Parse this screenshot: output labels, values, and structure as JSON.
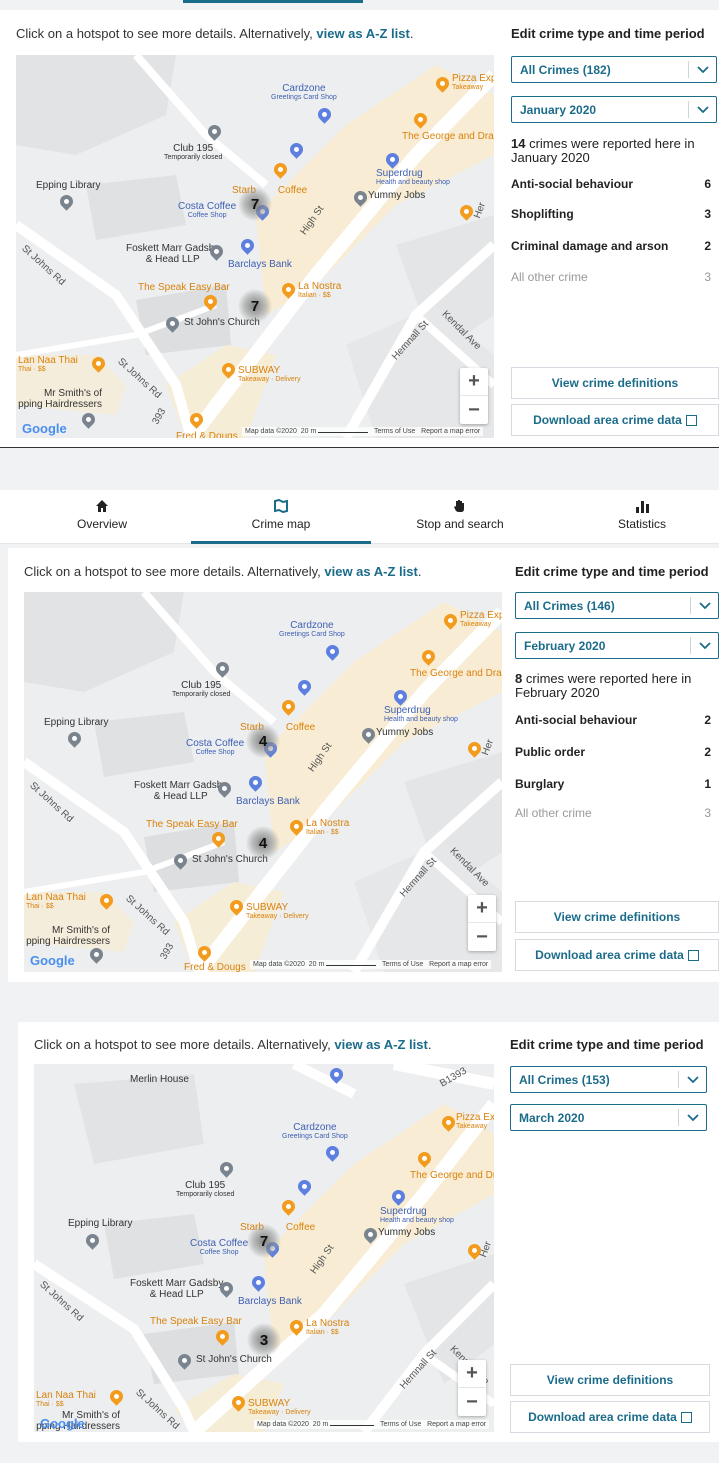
{
  "intro": {
    "text": "Click on a hotspot to see more details. Alternatively,",
    "link": "view as A-Z list",
    "end": "."
  },
  "side_title": "Edit crime type and time period",
  "tabs": [
    {
      "label": "Overview",
      "icon": "home-icon"
    },
    {
      "label": "Crime map",
      "icon": "map-icon"
    },
    {
      "label": "Stop and search",
      "icon": "hand-icon"
    },
    {
      "label": "Statistics",
      "icon": "bar-chart-icon"
    }
  ],
  "map": {
    "pois": {
      "cardzone": "Cardzone",
      "cardzone_sub": "Greetings Card Shop",
      "pizza": "Pizza Exp",
      "pizza_sub": "Takeaway",
      "george": "The George and Drag",
      "club": "Club 195",
      "club_sub": "Temporarily closed",
      "superdrug": "Superdrug",
      "superdrug_sub": "Health and beauty shop",
      "yummy": "Yummy Jobs",
      "library": "Epping Library",
      "starb": "Starb",
      "coffee_tail": "Coffee",
      "costa": "Costa Coffee",
      "costa_sub": "Coffee Shop",
      "foskett": "Foskett Marr Gadsby",
      "foskett2": "& Head LLP",
      "barclays": "Barclays Bank",
      "speakeasy": "The Speak Easy Bar",
      "lanostra": "La Nostra",
      "lanostra_sub": "Italian · $$",
      "stjohn": "St John's Church",
      "lannaa": "Lan Naa Thai",
      "lannaa_sub": "Thai · $$",
      "subway": "SUBWAY",
      "subway_sub": "Takeaway · Delivery",
      "smith": "Mr Smith's of",
      "smith2": "pping Hairdressers",
      "freddougs": "Fred & Dougs",
      "merlin": "Merlin House"
    },
    "roads": {
      "high": "High St",
      "hemnall": "Hemnall St",
      "stjohns": "St Johns Rd",
      "stjohns2": "St Johns Rd",
      "kendal": "Kendal Ave",
      "b1393": "B1393",
      "b1393b": "393",
      "her": "Her"
    },
    "attribution": {
      "mapdata": "Map data ©2020",
      "scale": "20 m",
      "terms": "Terms of Use",
      "report": "Report a map error"
    },
    "google": "Google"
  },
  "panels": [
    {
      "crime_select": "All Crimes (182)",
      "month_select": "January 2020",
      "count": "14",
      "summary_rest": "crimes were reported here in",
      "summary_month": "January 2020",
      "clusters": [
        "7",
        "7"
      ],
      "rows": [
        {
          "label": "Anti-social behaviour",
          "value": "6"
        },
        {
          "label": "Shoplifting",
          "value": "3"
        },
        {
          "label": "Criminal damage and arson",
          "value": "2"
        },
        {
          "label": "All other crime",
          "value": "3"
        }
      ]
    },
    {
      "crime_select": "All Crimes (146)",
      "month_select": "February 2020",
      "count": "8",
      "summary_rest": "crimes were reported here in",
      "summary_month": "February 2020",
      "clusters": [
        "4",
        "4"
      ],
      "rows": [
        {
          "label": "Anti-social behaviour",
          "value": "2"
        },
        {
          "label": "Public order",
          "value": "2"
        },
        {
          "label": "Burglary",
          "value": "1"
        },
        {
          "label": "All other crime",
          "value": "3"
        }
      ]
    },
    {
      "crime_select": "All Crimes (153)",
      "month_select": "March 2020",
      "clusters": [
        "7",
        "3"
      ]
    }
  ],
  "buttons": {
    "definitions": "View crime definitions",
    "download": "Download area crime data"
  },
  "colors": {
    "accent": "#1b6c8a",
    "road": "#ffffff",
    "orange": "#f29b1c",
    "blue": "#5c7fe0"
  }
}
